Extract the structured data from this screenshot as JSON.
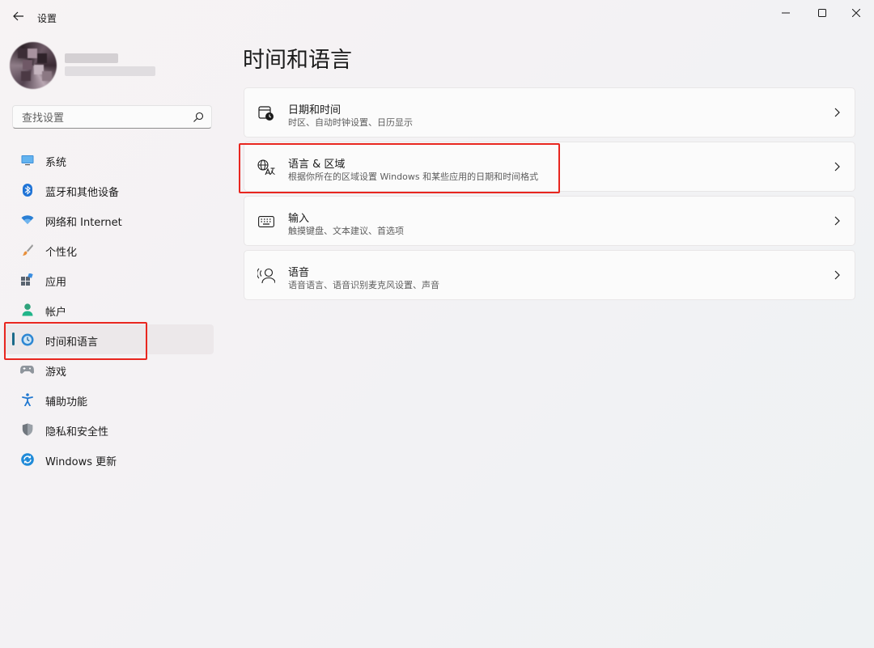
{
  "window": {
    "title": "设置"
  },
  "search": {
    "placeholder": "查找设置"
  },
  "nav": [
    {
      "label": "系统",
      "icon": "monitor-icon"
    },
    {
      "label": "蓝牙和其他设备",
      "icon": "bluetooth-icon"
    },
    {
      "label": "网络和 Internet",
      "icon": "wifi-icon"
    },
    {
      "label": "个性化",
      "icon": "brush-icon"
    },
    {
      "label": "应用",
      "icon": "apps-icon"
    },
    {
      "label": "帐户",
      "icon": "person-icon"
    },
    {
      "label": "时间和语言",
      "icon": "globe-clock-icon",
      "selected": true
    },
    {
      "label": "游戏",
      "icon": "gamepad-icon"
    },
    {
      "label": "辅助功能",
      "icon": "accessibility-icon"
    },
    {
      "label": "隐私和安全性",
      "icon": "shield-icon"
    },
    {
      "label": "Windows 更新",
      "icon": "windows-update-icon"
    }
  ],
  "page": {
    "title": "时间和语言"
  },
  "cards": [
    {
      "title": "日期和时间",
      "subtitle": "时区、自动时钟设置、日历显示",
      "icon": "calendar-clock-icon"
    },
    {
      "title": "语言 & 区域",
      "subtitle": "根据你所在的区域设置 Windows 和某些应用的日期和时间格式",
      "icon": "language-region-icon"
    },
    {
      "title": "输入",
      "subtitle": "触摸键盘、文本建议、首选项",
      "icon": "keyboard-icon"
    },
    {
      "title": "语音",
      "subtitle": "语音语言、语音识别麦克风设置、声音",
      "icon": "speech-icon"
    }
  ],
  "colors": {
    "accent": "#1a6a8a",
    "highlight": "#e8261f",
    "selected_bg": "#ece8ea"
  }
}
